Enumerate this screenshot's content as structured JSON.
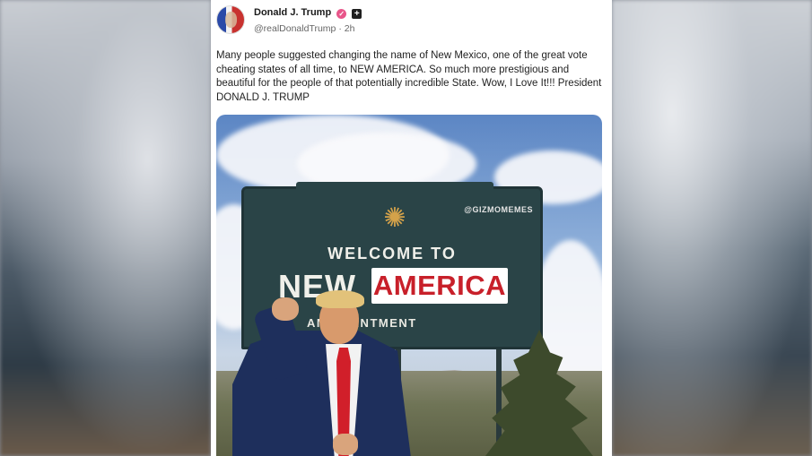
{
  "post": {
    "author_name": "Donald J. Trump",
    "handle": "@realDonaldTrump",
    "separator": "·",
    "time": "2h",
    "verified_icon": "verified-badge-icon",
    "plus_icon": "plus-badge-icon",
    "text": "Many people suggested changing the name of New Mexico, one of the great vote cheating states of all time, to NEW AMERICA. So much more prestigious and beautiful for the people of that potentially incredible State. Wow, I Love It!!! President DONALD J. TRUMP"
  },
  "image": {
    "watermark": "@GIZMOMEMES",
    "sign_welcome": "WELCOME TO",
    "sign_new": "NEW",
    "sign_america": "AMERICA",
    "sign_tagline": "AN   CHANTMENT"
  },
  "colors": {
    "sign_green": "#2a4447",
    "america_red": "#c8202a",
    "verified_pink": "#e8568a"
  }
}
